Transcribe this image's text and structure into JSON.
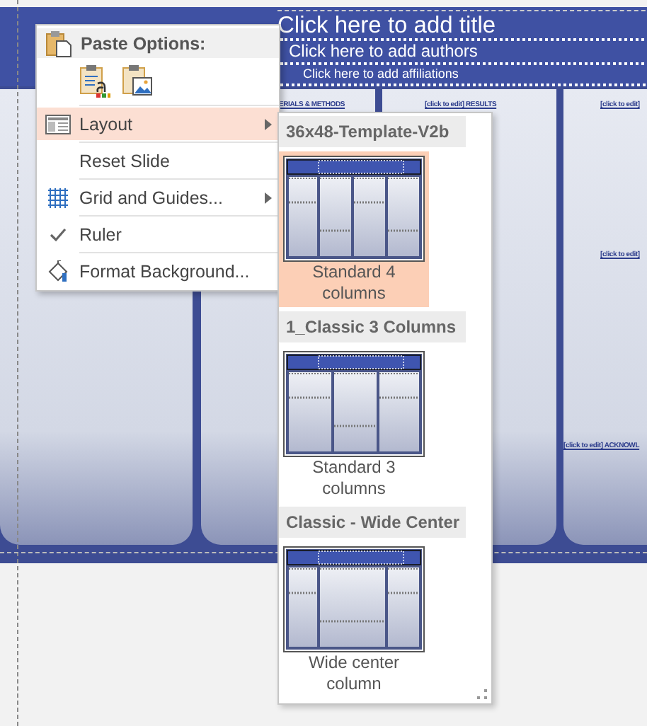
{
  "slide": {
    "title": "Click here to add title",
    "authors": "Click here to add authors",
    "affiliations": "Click here to add affiliations",
    "headings": [
      {
        "text": "ERIALS & METHODS"
      },
      {
        "text": "[click to edit] RESULTS"
      },
      {
        "text": "[click to edit]"
      },
      {
        "text": "[click to edit]"
      },
      {
        "text": "[click to edit] ACKNOWL"
      }
    ]
  },
  "context_menu": {
    "paste_options": {
      "title": "Paste Options:"
    },
    "items": [
      {
        "label": "Layout",
        "kind": "layout",
        "submenu": true,
        "selected": true,
        "checked": false
      },
      {
        "label": "Reset Slide",
        "kind": "plain",
        "submenu": false,
        "selected": false,
        "checked": false
      },
      {
        "label": "Grid and Guides...",
        "kind": "grid",
        "submenu": true,
        "selected": false,
        "checked": false
      },
      {
        "label": "Ruler",
        "kind": "toggle",
        "submenu": false,
        "selected": false,
        "checked": true
      },
      {
        "label": "Format Background...",
        "kind": "background",
        "submenu": false,
        "selected": false,
        "checked": false
      }
    ]
  },
  "layout_gallery": {
    "groups": [
      {
        "title": "36x48-Template-V2b",
        "layouts": [
          {
            "name": "Standard 4 columns",
            "kind": "four",
            "selected": true
          }
        ]
      },
      {
        "title": "1_Classic 3 Columns",
        "layouts": [
          {
            "name": "Standard 3 columns",
            "kind": "three",
            "selected": false
          }
        ]
      },
      {
        "title": "Classic - Wide Center",
        "layouts": [
          {
            "name": "Wide center column",
            "kind": "wide",
            "selected": false
          }
        ]
      }
    ]
  }
}
